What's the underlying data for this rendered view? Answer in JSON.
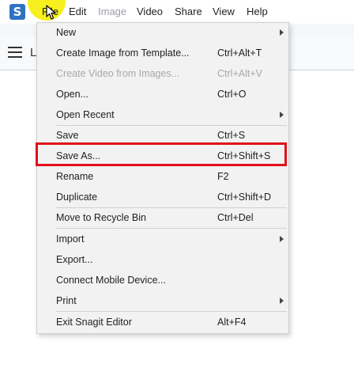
{
  "menubar": {
    "app_icon": "S",
    "menus": [
      {
        "label": "File",
        "disabled": false
      },
      {
        "label": "Edit",
        "disabled": false
      },
      {
        "label": "Image",
        "disabled": true
      },
      {
        "label": "Video",
        "disabled": false
      },
      {
        "label": "Share",
        "disabled": false
      },
      {
        "label": "View",
        "disabled": false
      },
      {
        "label": "Help",
        "disabled": false
      }
    ]
  },
  "toolbar": {
    "partial_text": "L"
  },
  "file_menu": {
    "items": [
      {
        "label": "New",
        "shortcut": "",
        "submenu": true,
        "disabled": false
      },
      {
        "label": "Create Image from Template...",
        "shortcut": "Ctrl+Alt+T",
        "submenu": false,
        "disabled": false
      },
      {
        "label": "Create Video from Images...",
        "shortcut": "Ctrl+Alt+V",
        "submenu": false,
        "disabled": true
      },
      {
        "label": "Open...",
        "shortcut": "Ctrl+O",
        "submenu": false,
        "disabled": false
      },
      {
        "label": "Open Recent",
        "shortcut": "",
        "submenu": true,
        "disabled": false
      },
      {
        "label": "Save",
        "shortcut": "Ctrl+S",
        "submenu": false,
        "disabled": false
      },
      {
        "label": "Save As...",
        "shortcut": "Ctrl+Shift+S",
        "submenu": false,
        "disabled": false
      },
      {
        "label": "Rename",
        "shortcut": "F2",
        "submenu": false,
        "disabled": false
      },
      {
        "label": "Duplicate",
        "shortcut": "Ctrl+Shift+D",
        "submenu": false,
        "disabled": false
      },
      {
        "label": "Move to Recycle Bin",
        "shortcut": "Ctrl+Del",
        "submenu": false,
        "disabled": false
      },
      {
        "label": "Import",
        "shortcut": "",
        "submenu": true,
        "disabled": false
      },
      {
        "label": "Export...",
        "shortcut": "",
        "submenu": false,
        "disabled": false
      },
      {
        "label": "Connect Mobile Device...",
        "shortcut": "",
        "submenu": false,
        "disabled": false
      },
      {
        "label": "Print",
        "shortcut": "",
        "submenu": true,
        "disabled": false
      },
      {
        "label": "Exit Snagit Editor",
        "shortcut": "Alt+F4",
        "submenu": false,
        "disabled": false
      }
    ],
    "highlighted_item": "Save As..."
  },
  "colors": {
    "highlight_circle": "#f7ef1e",
    "annotation_box": "#e0101a",
    "app_icon": "#2e72c4"
  }
}
